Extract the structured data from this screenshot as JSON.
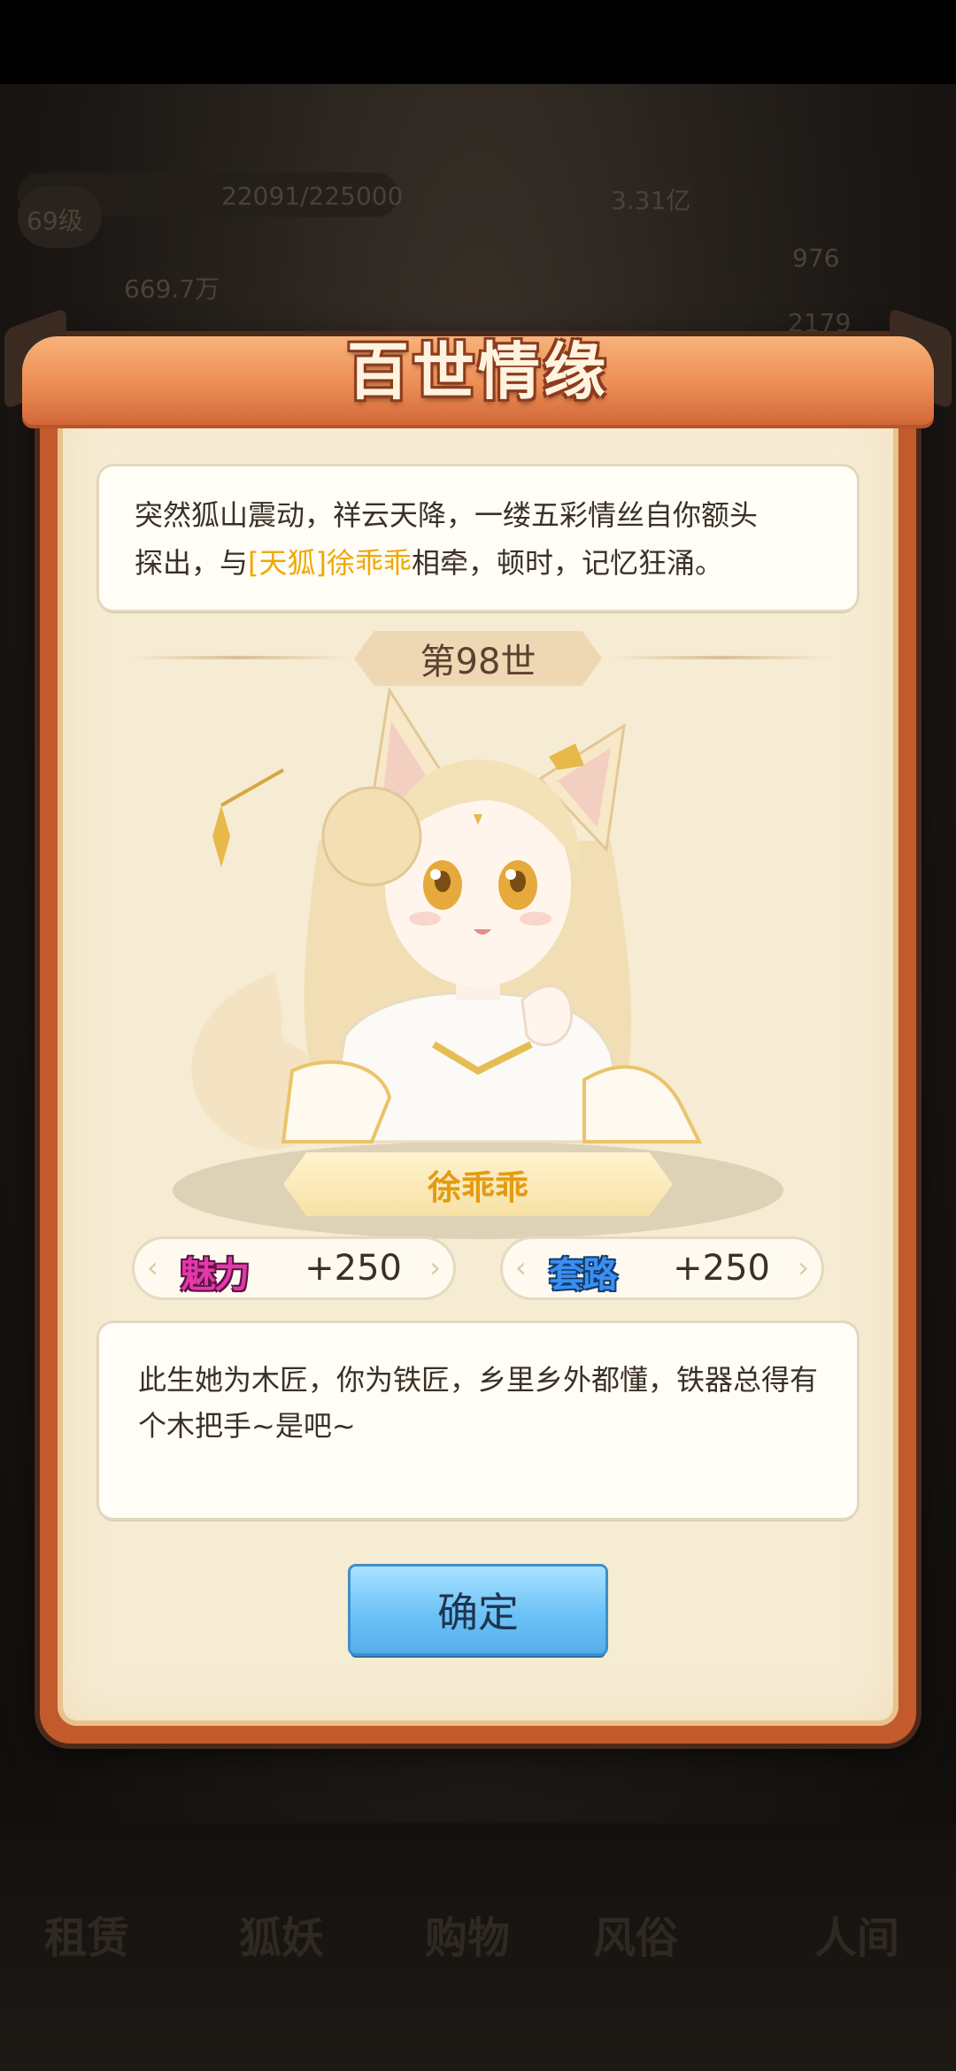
{
  "background": {
    "xp": "22091/225000",
    "level": "69级",
    "gold": "669.7万",
    "power": "3.31亿",
    "stat_a": "976",
    "stat_b": "2179",
    "nav": [
      "租赁",
      "狐妖",
      "购物",
      "风俗",
      "人间"
    ]
  },
  "dialog": {
    "title": "百世情缘",
    "intro_line1": "突然狐山震动，祥云天降，一缕五彩情丝自你额头",
    "intro_line2_pre": "探出，与",
    "intro_bracket_open": "[",
    "intro_tag": "天狐",
    "intro_bracket_close": "]",
    "intro_name": "徐乖乖",
    "intro_line2_post": "相牵，顿时，记忆狂涌。",
    "life_label": "第98世",
    "character_name": "徐乖乖",
    "stats": [
      {
        "label": "魅力",
        "value": "+250",
        "color": "#e538a9"
      },
      {
        "label": "套路",
        "value": "+250",
        "color": "#3a8ff1"
      }
    ],
    "description": "此生她为木匠，你为铁匠，乡里乡外都懂，铁器总得有个木把手~是吧~",
    "confirm_label": "确定"
  }
}
